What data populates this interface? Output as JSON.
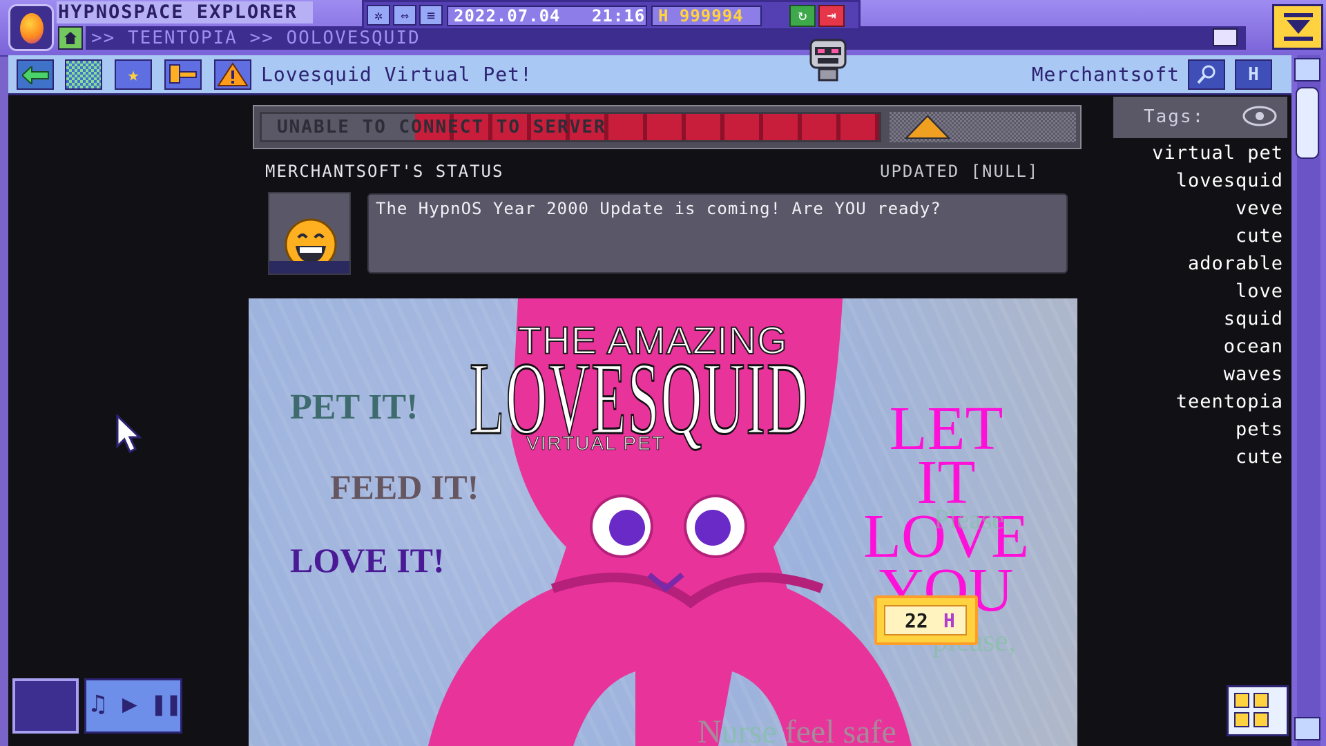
{
  "app": {
    "title": "HYPNOSPACE EXPLORER"
  },
  "address": {
    "path": ">> TEENTOPIA >> OOLOVESQUID"
  },
  "toolbar": {
    "date": "2022.07.04",
    "time": "21:16",
    "credits": "H 999994"
  },
  "nav": {
    "page_title": "Lovesquid Virtual Pet!",
    "author": "Merchantsoft",
    "h_button": "H"
  },
  "error": {
    "text": "UNABLE TO CONNECT TO SERVER"
  },
  "status": {
    "label": "MERCHANTSOFT'S STATUS",
    "updated": "UPDATED [NULL]",
    "message": "The HypnOS Year 2000 Update is coming! Are YOU ready?"
  },
  "banner": {
    "the_amazing": "THE AMAZING",
    "logo": "LOVESQUID",
    "subtitle": "VIRTUAL PET",
    "pet_it": "PET IT!",
    "feed_it": "FEED IT!",
    "love_it": "LOVE IT!",
    "let_it": "LET IT",
    "love": "LOVE",
    "you": "YOU",
    "price_value": "22",
    "price_currency": "H"
  },
  "tags": {
    "title": "Tags:",
    "items": [
      "virtual pet",
      "lovesquid",
      "veve",
      "cute",
      "adorable",
      "love",
      "squid",
      "ocean",
      "waves",
      "teentopia",
      "pets",
      "cute"
    ]
  },
  "colors": {
    "accent": "#7b63d8",
    "error_red": "#c81e3b",
    "pink": "#ff10d8",
    "page_bg": "#111014"
  }
}
